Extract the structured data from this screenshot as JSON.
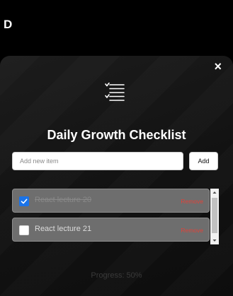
{
  "app": {
    "letter": "D"
  },
  "modal": {
    "close_label": "×",
    "logo_icon": "checklist-icon",
    "title": "Daily Growth Checklist",
    "new_item": {
      "placeholder": "Add new item",
      "value": ""
    },
    "add_label": "Add",
    "items": [
      {
        "text": "React lecture 20",
        "checked": true,
        "remove_label": "Remove"
      },
      {
        "text": "React lecture 21",
        "checked": false,
        "remove_label": "Remove"
      }
    ],
    "progress_text": "Progress: 50%",
    "progress_value": 0.5
  },
  "colors": {
    "accent": "#1a73e8",
    "remove": "#e0433a",
    "item_bg": "#6e6e6e"
  }
}
